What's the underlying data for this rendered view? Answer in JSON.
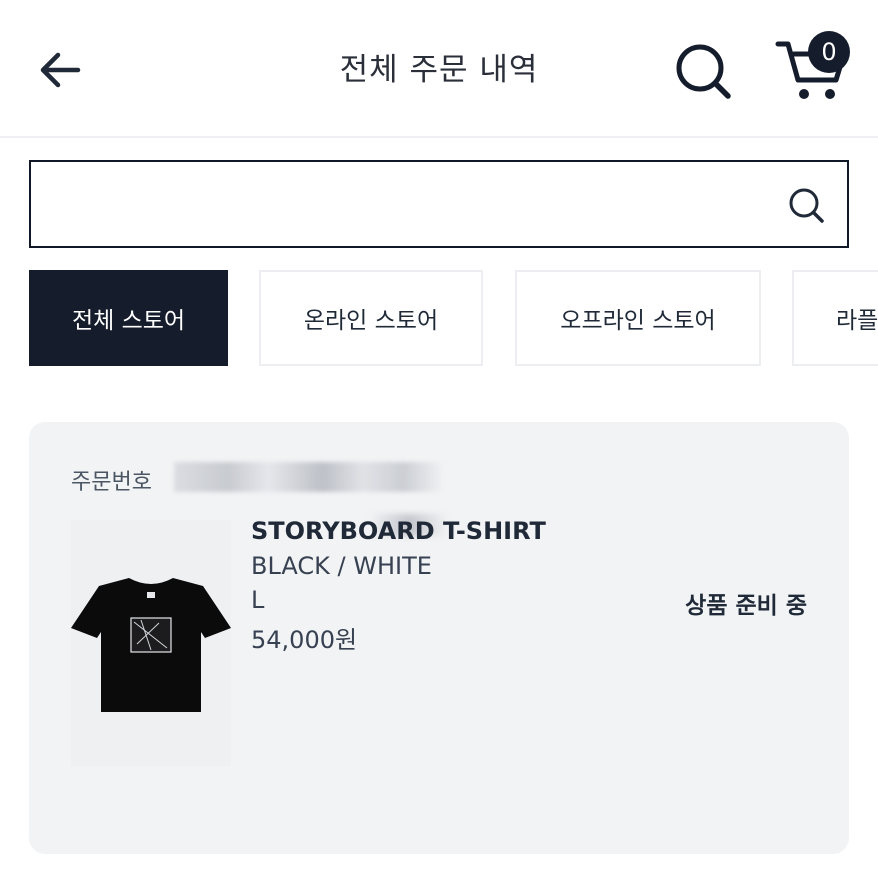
{
  "header": {
    "title": "전체 주문 내역",
    "cart_count": "0"
  },
  "search": {
    "value": "",
    "placeholder": ""
  },
  "tabs": [
    {
      "label": "전체 스토어",
      "active": true
    },
    {
      "label": "온라인 스토어",
      "active": false
    },
    {
      "label": "오프라인 스토어",
      "active": false
    },
    {
      "label": "라플",
      "active": false
    }
  ],
  "order": {
    "number_label": "주문번호",
    "product": {
      "name": "STORYBOARD T-SHIRT",
      "option": "BLACK / WHITE",
      "size": "L",
      "price": "54,000원"
    },
    "status": "상품 준비 중"
  },
  "colors": {
    "accent": "#151c2c",
    "card_bg": "#f2f3f5"
  }
}
